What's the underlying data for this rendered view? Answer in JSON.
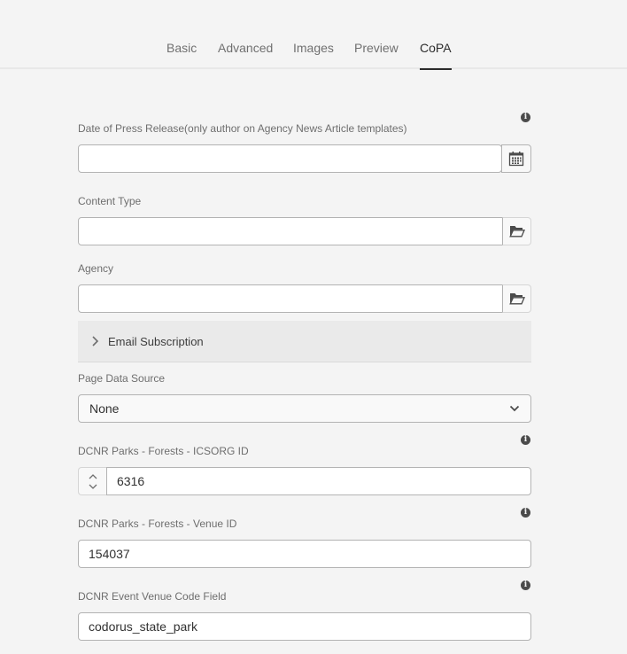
{
  "tabs": [
    {
      "label": "Basic",
      "active": false
    },
    {
      "label": "Advanced",
      "active": false
    },
    {
      "label": "Images",
      "active": false
    },
    {
      "label": "Preview",
      "active": false
    },
    {
      "label": "CoPA",
      "active": true
    }
  ],
  "fields": {
    "press_release_date": {
      "label": "Date of Press Release(only author on Agency News Article templates)",
      "value": "",
      "icon": "calendar-icon",
      "has_info": true
    },
    "content_type": {
      "label": "Content Type",
      "value": "",
      "icon": "folder-icon"
    },
    "agency": {
      "label": "Agency",
      "value": "",
      "icon": "folder-icon"
    },
    "email_subscription": {
      "label": "Email Subscription",
      "expanded": false
    },
    "page_data_source": {
      "label": "Page Data Source",
      "selected": "None"
    },
    "icsorg_id": {
      "label": "DCNR Parks - Forests - ICSORG ID",
      "value": "6316",
      "has_info": true
    },
    "venue_id": {
      "label": "DCNR Parks - Forests - Venue ID",
      "value": "154037",
      "has_info": true
    },
    "venue_code": {
      "label": "DCNR Event Venue Code Field",
      "value": "codorus_state_park",
      "has_info": true
    }
  },
  "info_glyph": "i"
}
